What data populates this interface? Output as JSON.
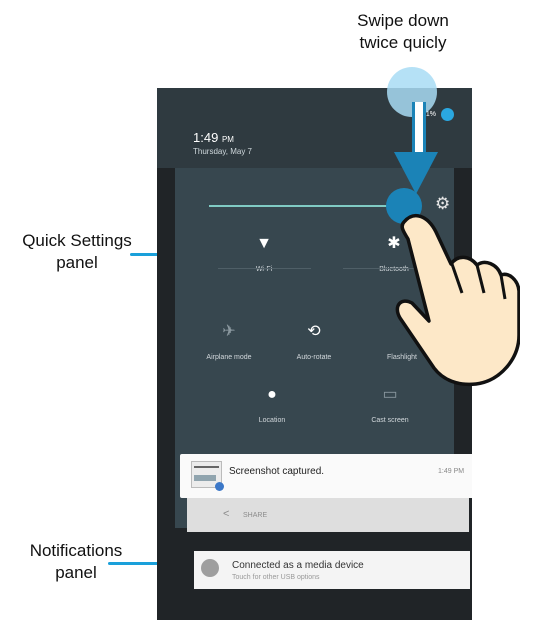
{
  "annotations": {
    "swipe": "Swipe down\ntwice quicly",
    "quick_settings": "Quick Settings\npanel",
    "notifications": "Notifications\npanel"
  },
  "status_bar": {
    "battery": "21%",
    "time_main": "1:49",
    "time_suffix": "PM",
    "date": "Thursday, May 7"
  },
  "quick_settings": {
    "tiles": [
      {
        "label": "Wi-Fi",
        "icon": "wifi-icon"
      },
      {
        "label": "Bluetooth",
        "icon": "bluetooth-icon"
      },
      {
        "label": "Airplane mode",
        "icon": "airplane-icon"
      },
      {
        "label": "Auto-rotate",
        "icon": "rotate-icon"
      },
      {
        "label": "Flashlight",
        "icon": "flashlight-icon"
      },
      {
        "label": "Location",
        "icon": "location-icon"
      },
      {
        "label": "Cast screen",
        "icon": "cast-icon"
      }
    ],
    "brightness_icon": "gear-icon"
  },
  "notifications": {
    "screenshot": {
      "title": "Screenshot captured.",
      "time": "1:49 PM",
      "action": "SHARE"
    },
    "usb": {
      "title": "Connected as a media device",
      "subtitle": "Touch for other USB options"
    }
  },
  "colors": {
    "accent": "#1b83b7",
    "callout": "#1aa0da",
    "panel": "#37474f"
  }
}
